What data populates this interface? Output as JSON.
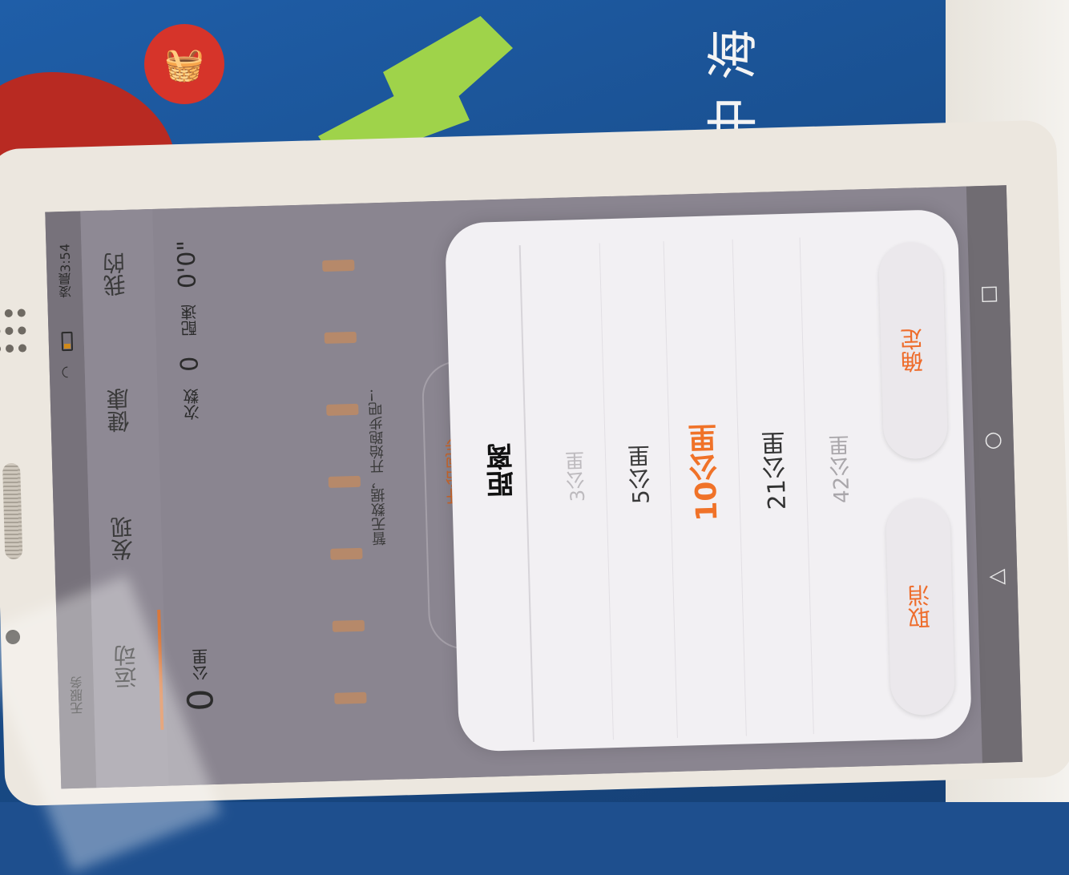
{
  "background": {
    "chars": "中海",
    "cart_icon": "shopping-cart-icon"
  },
  "status_bar": {
    "carrier": "无服务",
    "time": "凌晨3:54"
  },
  "tabs": {
    "mine": "我的",
    "health": "健康",
    "discover": "发现",
    "sport": "运动"
  },
  "summary": {
    "pace_label": "配速",
    "pace_value": "0'0\"",
    "count_label": "次数",
    "count_value": "0",
    "distance_value": "0",
    "distance_unit": "公里"
  },
  "empty_state": {
    "message": "暂无数据，开始跑步吧！",
    "start_button": "开始跑步"
  },
  "dialog": {
    "title": "距离",
    "options": [
      "3公里",
      "5公里",
      "10公里",
      "21公里",
      "42公里"
    ],
    "selected": "10公里",
    "confirm": "确定",
    "cancel": "取消"
  },
  "colors": {
    "accent": "#f07228",
    "dialog_bg": "#f2f0f3"
  }
}
